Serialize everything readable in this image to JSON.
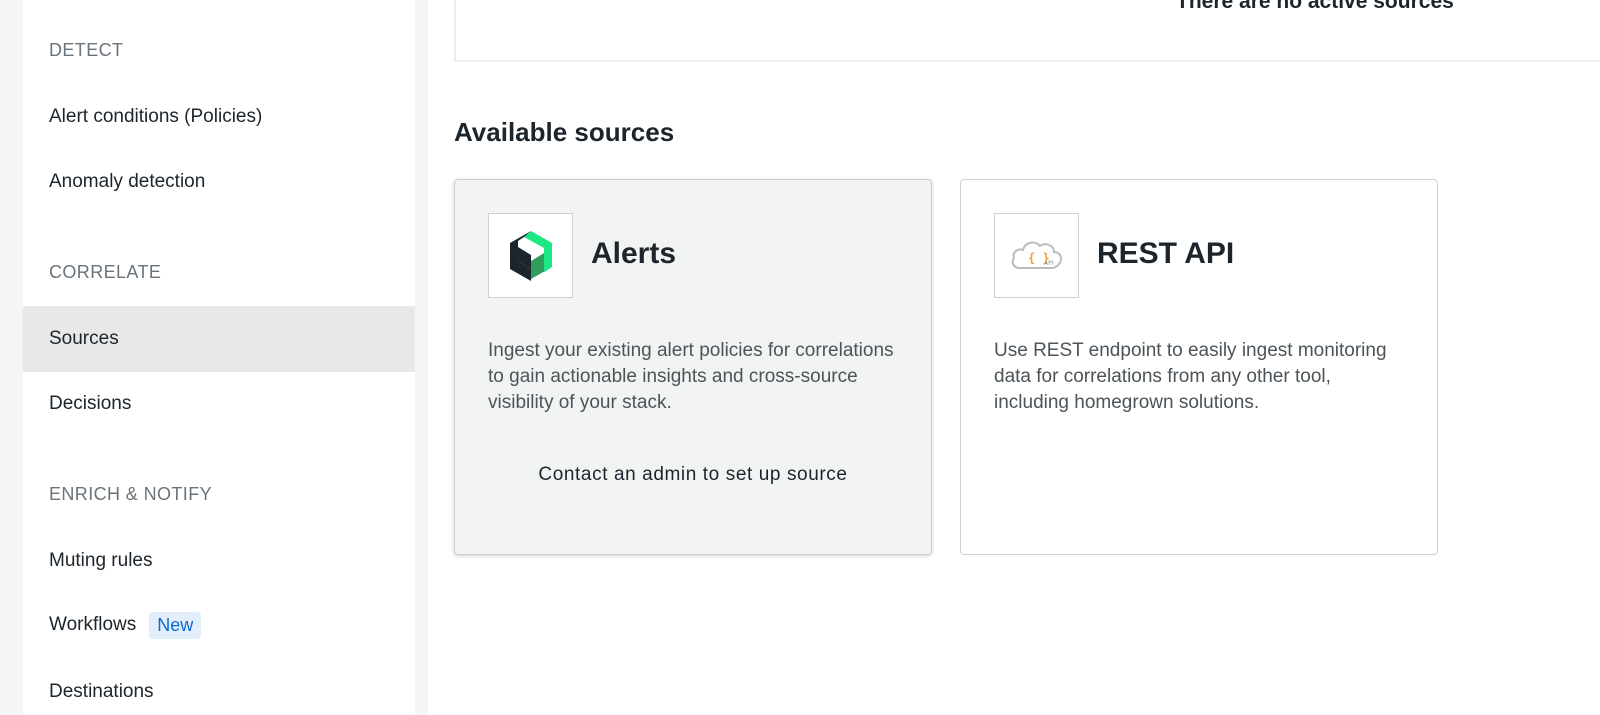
{
  "sidebar": {
    "sections": [
      {
        "header": "DETECT",
        "items": [
          {
            "label": "Alert conditions (Policies)"
          },
          {
            "label": "Anomaly detection"
          }
        ]
      },
      {
        "header": "CORRELATE",
        "items": [
          {
            "label": "Sources",
            "active": true
          },
          {
            "label": "Decisions"
          }
        ]
      },
      {
        "header": "ENRICH & NOTIFY",
        "items": [
          {
            "label": "Muting rules"
          },
          {
            "label": "Workflows",
            "badge": "New"
          },
          {
            "label": "Destinations"
          }
        ]
      }
    ]
  },
  "main": {
    "active_sources_message": "There are no active sources",
    "available_title": "Available sources",
    "cards": [
      {
        "title": "Alerts",
        "icon": "new-relic-logo-icon",
        "description": "Ingest your existing alert policies for correlations to gain actionable insights and cross-source visibility of your stack.",
        "action": "Contact an admin to set up source"
      },
      {
        "title": "REST API",
        "icon": "cloud-api-icon",
        "description": "Use REST endpoint to easily ingest monitoring data for correlations from any other tool, including homegrown solutions."
      }
    ]
  },
  "colors": {
    "accent_blue": "#0d6ad1",
    "badge_bg": "#e3eefb",
    "logo_green": "#1ce783",
    "logo_dark": "#1d252c"
  }
}
